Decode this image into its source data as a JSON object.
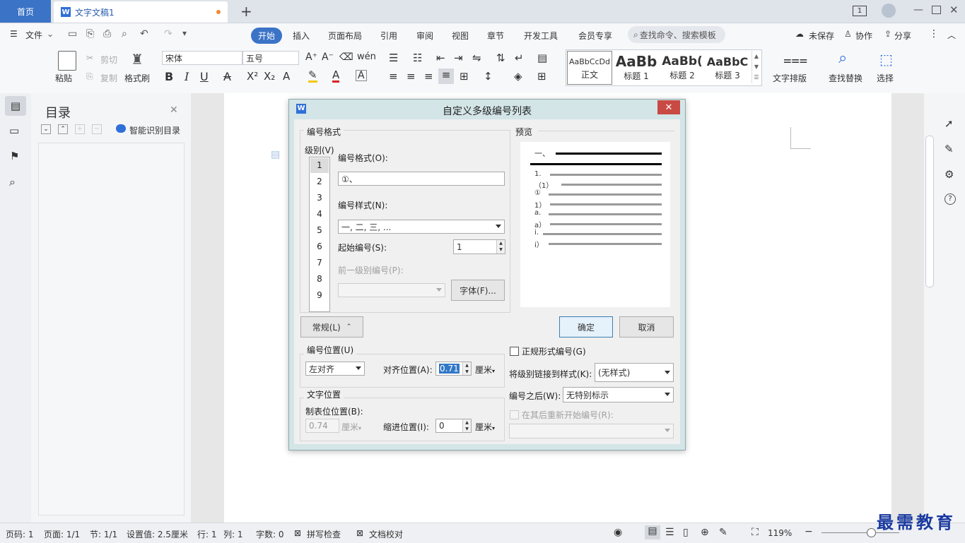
{
  "tabs": {
    "home": "首页",
    "doc_title": "文字文稿1",
    "new_tab": "+"
  },
  "window": {
    "page_indicator": "1"
  },
  "menubar": {
    "file": "文件",
    "items": [
      "开始",
      "插入",
      "页面布局",
      "引用",
      "审阅",
      "视图",
      "章节",
      "开发工具",
      "会员专享"
    ],
    "search_placeholder": "查找命令、搜索模板",
    "right": [
      "未保存",
      "协作",
      "分享"
    ]
  },
  "ribbon": {
    "paste": "粘贴",
    "cut": "剪切",
    "copy": "复制",
    "format_painter": "格式刷",
    "font": "宋体",
    "size": "五号",
    "styles": [
      {
        "sample": "AaBbCcDd",
        "name": "正文"
      },
      {
        "sample": "AaBb",
        "name": "标题 1"
      },
      {
        "sample": "AaBb(",
        "name": "标题 2"
      },
      {
        "sample": "AaBbC",
        "name": "标题 3"
      }
    ],
    "text_layout": "文字排版",
    "find_replace": "查找替换",
    "select": "选择"
  },
  "outline": {
    "title": "目录",
    "smart": "智能识别目录"
  },
  "dialog": {
    "title": "自定义多级编号列表",
    "close": "✕",
    "group_format": "编号格式",
    "level_label": "级别(V)",
    "levels": [
      "1",
      "2",
      "3",
      "4",
      "5",
      "6",
      "7",
      "8",
      "9"
    ],
    "number_format_label": "编号格式(O):",
    "number_format_value": "①、",
    "number_style_label": "编号样式(N):",
    "number_style_value": "一, 二, 三, ...",
    "start_label": "起始编号(S):",
    "start_value": "1",
    "prev_level_label": "前一级别编号(P):",
    "font_button": "字体(F)...",
    "preview_label": "预览",
    "preview_items": [
      "一、",
      "1.",
      "（1）",
      "①",
      "1）",
      "a.",
      "a）",
      "i.",
      "i）"
    ],
    "normal_button": "常规(L)",
    "ok": "确定",
    "cancel": "取消",
    "number_position_label": "编号位置(U)",
    "align_value": "左对齐",
    "align_pos_label": "对齐位置(A):",
    "align_pos_value": "0.71",
    "unit": "厘米",
    "text_position_label": "文字位置",
    "tab_stop_label": "制表位位置(B):",
    "tab_stop_value": "0.74",
    "indent_label": "缩进位置(I):",
    "indent_value": "0",
    "legal_label": "正规形式编号(G)",
    "link_label": "将级别链接到样式(K):",
    "link_value": "(无样式)",
    "after_label": "编号之后(W):",
    "after_value": "无特别标示",
    "restart_label": "在其后重新开始编号(R):"
  },
  "status": {
    "page": "页码: 1",
    "pages": "页面: 1/1",
    "section": "节: 1/1",
    "setting": "设置值: 2.5厘米",
    "row": "行: 1",
    "col": "列: 1",
    "words": "字数: 0",
    "spell": "拼写检查",
    "proof": "文档校对",
    "zoom": "119%"
  },
  "watermark": "最需教育"
}
